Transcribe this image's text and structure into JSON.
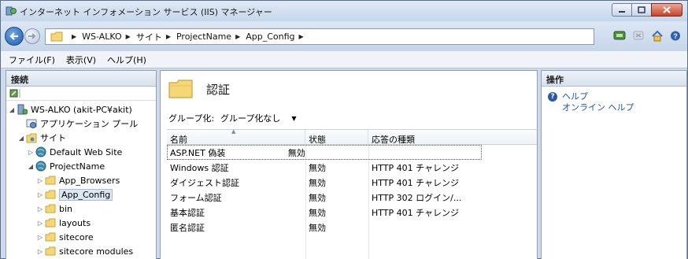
{
  "window": {
    "title": "インターネット インフォメーション サービス (IIS) マネージャー"
  },
  "address": {
    "breadcrumbs": [
      "WS-ALKO",
      "サイト",
      "ProjectName",
      "App_Config"
    ]
  },
  "menu": {
    "items": [
      "ファイル(F)",
      "表示(V)",
      "ヘルプ(H)"
    ]
  },
  "left_pane": {
    "title": "接続",
    "tree": [
      {
        "label": "WS-ALKO (akit-PC¥akit)",
        "icon": "server-icon"
      },
      {
        "label": "アプリケーション プール",
        "icon": "app-pool-icon"
      },
      {
        "label": "サイト",
        "icon": "sites-folder-icon"
      },
      {
        "label": "Default Web Site",
        "icon": "globe-icon"
      },
      {
        "label": "ProjectName",
        "icon": "globe-icon"
      },
      {
        "label": "App_Browsers",
        "icon": "folder-icon"
      },
      {
        "label": "App_Config",
        "icon": "folder-icon"
      },
      {
        "label": "bin",
        "icon": "folder-icon"
      },
      {
        "label": "layouts",
        "icon": "folder-icon"
      },
      {
        "label": "sitecore",
        "icon": "folder-icon"
      },
      {
        "label": "sitecore modules",
        "icon": "folder-icon"
      }
    ]
  },
  "center": {
    "title": "認証",
    "group_by_label": "グループ化:",
    "group_by_value": "グループ化なし",
    "columns": [
      "名前",
      "状態",
      "応答の種類"
    ],
    "rows": [
      [
        "ASP.NET 偽装",
        "無効",
        ""
      ],
      [
        "Windows 認証",
        "無効",
        "HTTP 401 チャレンジ"
      ],
      [
        "ダイジェスト認証",
        "無効",
        "HTTP 401 チャレンジ"
      ],
      [
        "フォーム認証",
        "無効",
        "HTTP 302 ログイン/..."
      ],
      [
        "基本認証",
        "無効",
        "HTTP 401 チャレンジ"
      ],
      [
        "匿名認証",
        "無効",
        ""
      ]
    ]
  },
  "right_pane": {
    "title": "操作",
    "help": "ヘルプ",
    "online_help": "オンライン ヘルプ"
  },
  "colors": {
    "link": "#1a55b0",
    "chrome": "#cfdbeb",
    "close": "#c8432a"
  }
}
